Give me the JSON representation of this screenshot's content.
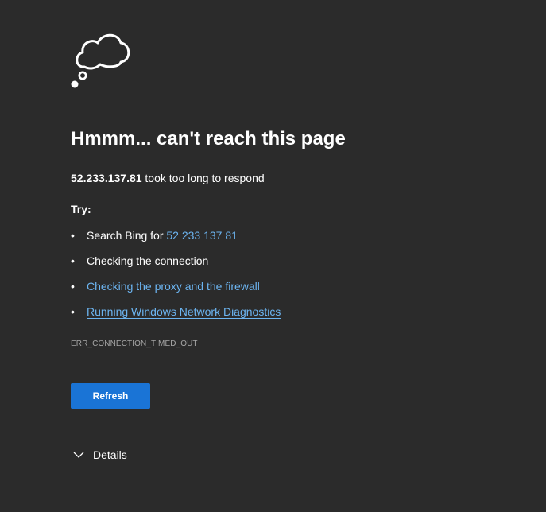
{
  "icon": "thought-cloud-icon",
  "heading": "Hmmm... can't reach this page",
  "summary": {
    "host": "52.233.137.81",
    "message": " took too long to respond"
  },
  "try_label": "Try:",
  "suggestions": [
    {
      "prefix": "Search Bing for ",
      "link": "52 233 137 81"
    },
    {
      "text": "Checking the connection"
    },
    {
      "link": "Checking the proxy and the firewall"
    },
    {
      "link": "Running Windows Network Diagnostics"
    }
  ],
  "error_code": "ERR_CONNECTION_TIMED_OUT",
  "refresh_label": "Refresh",
  "details_label": "Details",
  "colors": {
    "background": "#2b2b2b",
    "link": "#6cb4f0",
    "button": "#1a74d6",
    "muted": "#a6a6a6"
  }
}
